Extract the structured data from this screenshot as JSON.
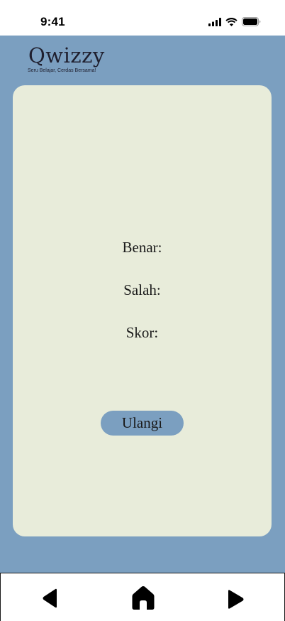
{
  "status_bar": {
    "time": "9:41",
    "icons": [
      "signal-icon",
      "wifi-icon",
      "battery-icon"
    ]
  },
  "app": {
    "title": "Qwizzy",
    "tagline": "Seru Belajar, Cerdas Bersama!"
  },
  "result": {
    "benar_label": "Benar:",
    "salah_label": "Salah:",
    "skor_label": "Skor:",
    "retry_label": "Ulangi"
  },
  "nav": {
    "items": [
      "back-arrow-icon",
      "home-icon",
      "forward-arrow-icon"
    ]
  },
  "colors": {
    "app_background": "#7b9fc0",
    "card_background": "#e8ecda",
    "button_background": "#7b9fc0",
    "text": "#1a1a1a"
  }
}
